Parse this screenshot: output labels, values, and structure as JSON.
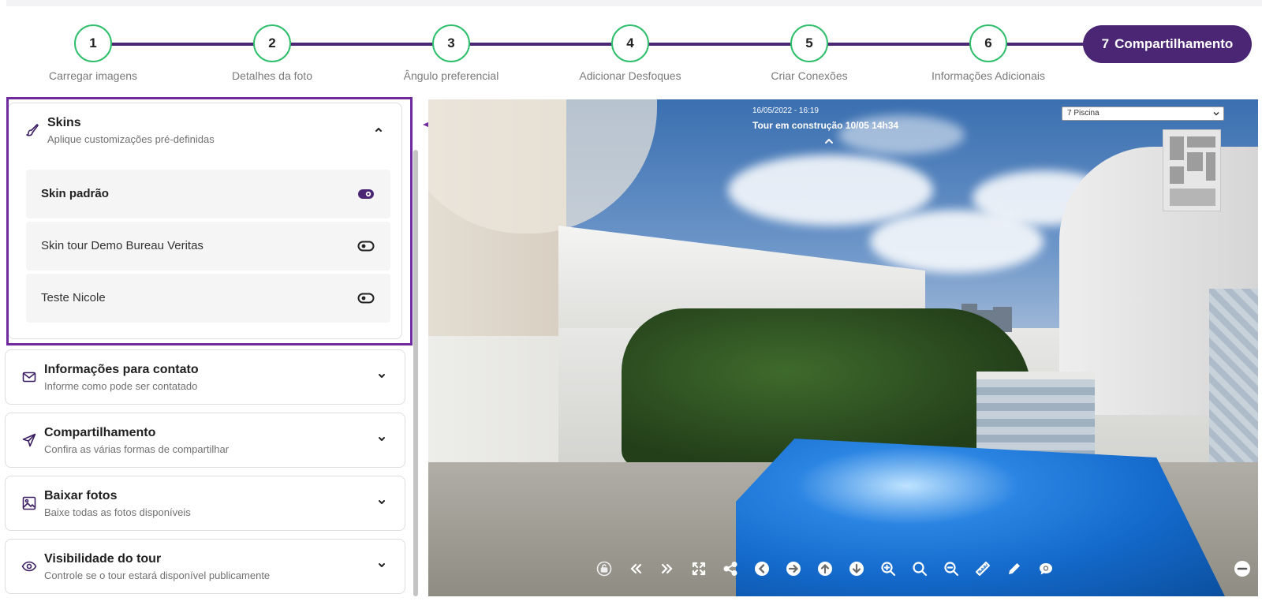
{
  "stepper": {
    "steps": [
      {
        "number": "1",
        "label": "Carregar imagens"
      },
      {
        "number": "2",
        "label": "Detalhes da foto"
      },
      {
        "number": "3",
        "label": "Ângulo preferencial"
      },
      {
        "number": "4",
        "label": "Adicionar Desfoques"
      },
      {
        "number": "5",
        "label": "Criar Conexões"
      },
      {
        "number": "6",
        "label": "Informações Adicionais"
      }
    ],
    "active": {
      "number": "7",
      "label": "Compartilhamento"
    }
  },
  "sidebar": {
    "skins": {
      "title": "Skins",
      "subtitle": "Aplique customizações pré-definidas",
      "items": [
        {
          "label": "Skin padrão",
          "selected": true
        },
        {
          "label": "Skin tour Demo Bureau Veritas",
          "selected": false
        },
        {
          "label": "Teste Nicole",
          "selected": false
        }
      ]
    },
    "panels": [
      {
        "title": "Informações para contato",
        "subtitle": "Informe como pode ser contatado",
        "icon": "mail-icon"
      },
      {
        "title": "Compartilhamento",
        "subtitle": "Confira as várias formas de compartilhar",
        "icon": "send-icon"
      },
      {
        "title": "Baixar fotos",
        "subtitle": "Baixe todas as fotos disponíveis",
        "icon": "image-icon"
      },
      {
        "title": "Visibilidade do tour",
        "subtitle": "Controle se o tour estará disponível publicamente",
        "icon": "eye-icon"
      }
    ]
  },
  "viewer": {
    "date": "16/05/2022 - 16:19",
    "title": "Tour em construção 10/05 14h34",
    "scene_select": "7 Piscina"
  },
  "colors": {
    "primary": "#4a2674",
    "step_border": "#2fbf6c",
    "highlight": "#6f2aa0"
  }
}
